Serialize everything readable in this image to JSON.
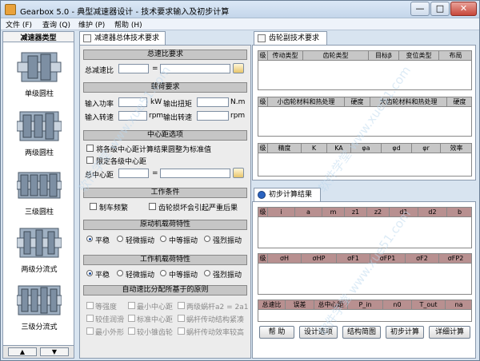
{
  "window": {
    "title": "Gearbox 5.0 - 典型减速器设计 - 技术要求输入及初步计算",
    "controls": {
      "minimize": "—",
      "maximize": "□",
      "close": "✕"
    }
  },
  "menu": [
    "文件 (F)",
    "查询 (Q)",
    "维护 (P)",
    "帮助 (H)"
  ],
  "left": {
    "title": "减速器类型",
    "items": [
      "单级圆柱",
      "两级圆柱",
      "三级圆柱",
      "两级分流式",
      "三级分流式"
    ],
    "nav": [
      "▲",
      "▼"
    ]
  },
  "tabs": {
    "mid": "减速器总体技术要求",
    "right_top": "齿轮副技术要求",
    "right_bottom": "初步计算结果"
  },
  "ratio": {
    "head": "总速比要求",
    "label": "总减速比",
    "eq": "="
  },
  "load": {
    "head": "载荷要求",
    "power": "输入功率",
    "power_unit": "kW",
    "torque": "输出扭矩",
    "torque_unit": "N.m",
    "in_speed": "输入转速",
    "in_unit": "rpm",
    "out_speed": "输出转速",
    "out_unit": "rpm"
  },
  "center": {
    "head": "中心距选项",
    "opt1": "将各级中心距计算结果圆整为标准值",
    "opt2": "限定各级中心距",
    "total": "总中心距",
    "eq": "="
  },
  "work": {
    "head": "工作条件",
    "opt1": "制车频繁",
    "opt2": "齿轮损坏会引起严重后果"
  },
  "prime": {
    "head": "原动机载荷特性",
    "opts": [
      "平稳",
      "轻微振动",
      "中等振动",
      "强烈振动"
    ],
    "selected": 0
  },
  "driven": {
    "head": "工作机载荷特性",
    "opts": [
      "平稳",
      "轻微振动",
      "中等振动",
      "强烈振动"
    ],
    "selected": 0
  },
  "dist": {
    "head": "自动速比分配所基于的原则",
    "opts": [
      "等强度",
      "最小中心距",
      "两级蜗杆a2 = 2a1",
      "较佳润滑",
      "标准中心距",
      "蜗杆传动结构紧凑",
      "最小外形",
      "较小锥齿轮",
      "蜗杆传动效率较高"
    ]
  },
  "grid1": [
    "级",
    "传动类型",
    "齿轮类型",
    "目标β",
    "变位类型",
    "布局"
  ],
  "grid2": [
    "级",
    "小齿轮材料和热处理",
    "硬度",
    "大齿轮材料和热处理",
    "硬度"
  ],
  "grid3": [
    "级",
    "精度",
    "K",
    "KA",
    "φa",
    "φd",
    "φr",
    "效率"
  ],
  "grid4": [
    "级",
    "i",
    "a",
    "m",
    "z1",
    "z2",
    "d1",
    "d2",
    "b"
  ],
  "grid5": [
    "级",
    "σH",
    "σHP",
    "σF1",
    "σFP1",
    "σF2",
    "σFP2"
  ],
  "grid6": [
    "总速比",
    "误差",
    "总中心距",
    "P_in",
    "n0",
    "T_out",
    "na"
  ],
  "buttons": [
    "帮 助",
    "设计选项",
    "结构简图",
    "初步计算",
    "详细计算"
  ],
  "watermark": "软件学堂 www.xue51.com"
}
